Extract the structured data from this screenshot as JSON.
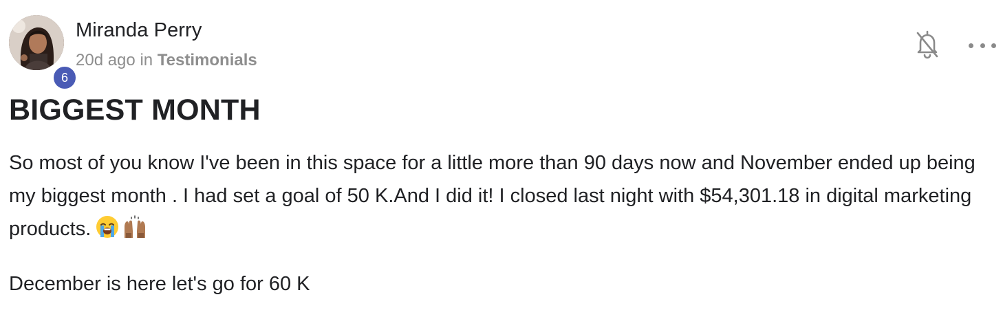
{
  "author": {
    "name": "Miranda Perry",
    "level": "6",
    "time_ago": "20d ago",
    "in_label": "in",
    "category": "Testimonials"
  },
  "post": {
    "title": "BIGGEST MONTH",
    "paragraph_1": "So most of you know I've been in this space for a little more than 90 days now and November ended up being my biggest month . I had set a goal of 50 K.And I did it! I closed last night with $54,301.18 in digital marketing products.",
    "paragraph_2": "December is here let's go for 60 K"
  },
  "icons": {
    "avatar": "profile-photo",
    "notifications": "bell-off-icon",
    "more": "more-horizontal-icon",
    "emoji_1": "loudly-crying-face",
    "emoji_2": "raising-hands"
  },
  "colors": {
    "badge": "#4a5bb5",
    "muted_text": "#8e8e8e",
    "text": "#202124"
  }
}
